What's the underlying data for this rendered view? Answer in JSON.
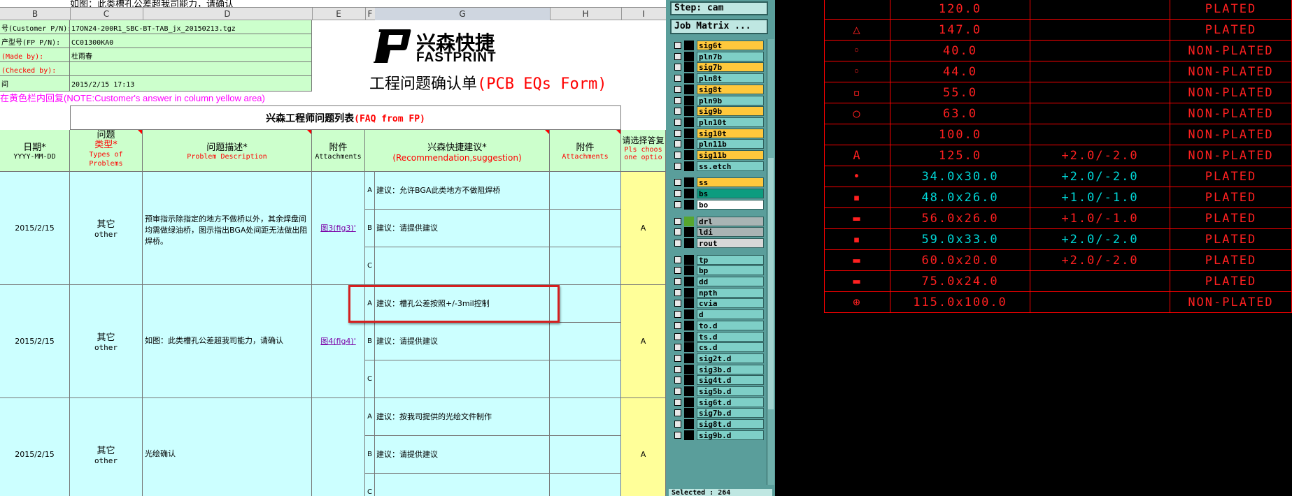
{
  "formula_text": "如图：此类槽孔公差超我司能力，请确认",
  "columns": [
    "B",
    "C",
    "D",
    "E",
    "F",
    "G",
    "H",
    "I"
  ],
  "info": [
    {
      "label": "号(Customer P/N):",
      "value": "17ON24-200R1_SBC-BT-TAB_jx_20150213.tgz"
    },
    {
      "label": "产型号(FP P/N):",
      "value": "CC01300KA0"
    },
    {
      "label": "(Made by):",
      "value": "杜雨春"
    },
    {
      "label": "(Checked by):",
      "value": ""
    },
    {
      "label": "间",
      "value": "2015/2/15 17:13"
    }
  ],
  "logo": {
    "cn": "兴森快捷",
    "en": "FASTPRINT",
    "mark": "P"
  },
  "form_title": {
    "cn": "工程问题确认单",
    "en": "(PCB EQs Form)"
  },
  "note": {
    "cn": "在黄色栏内回复",
    "en": "(NOTE:Customer's answer in column yellow area)"
  },
  "faq_title": {
    "cn": "兴森工程师问题列表",
    "en": "(FAQ from FP)"
  },
  "headers": {
    "date": {
      "cn": "日期*",
      "en": "YYYY-MM-DD"
    },
    "type": {
      "cn": "问题",
      "cn2": "类型*",
      "en": "Types of",
      "en2": "Problems"
    },
    "desc": {
      "cn": "问题描述*",
      "en": "Problem Description"
    },
    "att1": {
      "cn": "附件",
      "en": "Attachments"
    },
    "rec": {
      "cn": "兴森快捷建议*",
      "en": "(Recommendation,suggestion)"
    },
    "att2": {
      "cn": "附件",
      "en": "Attachments"
    },
    "ans": {
      "cn": "请选择答复",
      "en": "Pls choos",
      "en2": "one optio"
    }
  },
  "problems": [
    {
      "date": "2015/2/15",
      "type_cn": "其它",
      "type_en": "other",
      "desc": "预审指示除指定的地方不做桥以外，其余焊盘间均需做绿油桥，图示指出BGA处间距无法做出阻焊桥。",
      "attachment": "图3(fig3)'",
      "options": [
        {
          "letter": "A",
          "text": "建议：允许BGA此类地方不做阻焊桥"
        },
        {
          "letter": "B",
          "text": "建议：请提供建议"
        },
        {
          "letter": "C",
          "text": ""
        }
      ],
      "answer": "A"
    },
    {
      "date": "2015/2/15",
      "type_cn": "其它",
      "type_en": "other",
      "desc": "如图：此类槽孔公差超我司能力，请确认",
      "attachment": "图4(fig4)'",
      "options": [
        {
          "letter": "A",
          "text": "建议：槽孔公差按照+/-3mil控制"
        },
        {
          "letter": "B",
          "text": "建议：请提供建议"
        },
        {
          "letter": "C",
          "text": ""
        }
      ],
      "answer": "A"
    },
    {
      "date": "2015/2/15",
      "type_cn": "其它",
      "type_en": "other",
      "desc": "光绘确认",
      "attachment": "",
      "options": [
        {
          "letter": "A",
          "text": "建议：按我司提供的光绘文件制作"
        },
        {
          "letter": "B",
          "text": "建议：请提供建议"
        },
        {
          "letter": "C",
          "text": ""
        }
      ],
      "answer": "A"
    }
  ],
  "cam": {
    "step": "Step: cam",
    "job_matrix": "Job Matrix ...",
    "selected": "Selected : 264",
    "layers": [
      {
        "name": "sig6t",
        "color": "#ffc83c"
      },
      {
        "name": "pln7b",
        "color": "#7ecfc7"
      },
      {
        "name": "sig7b",
        "color": "#ffc83c"
      },
      {
        "name": "pln8t",
        "color": "#7ecfc7"
      },
      {
        "name": "sig8t",
        "color": "#ffc83c"
      },
      {
        "name": "pln9b",
        "color": "#7ecfc7"
      },
      {
        "name": "sig9b",
        "color": "#ffc83c"
      },
      {
        "name": "pln10t",
        "color": "#7ecfc7"
      },
      {
        "name": "sig10t",
        "color": "#ffc83c"
      },
      {
        "name": "pln11b",
        "color": "#7ecfc7"
      },
      {
        "name": "sig11b",
        "color": "#ffc83c"
      },
      {
        "name": "ss.etch",
        "color": "#7ecfc7"
      },
      {
        "name": "ss",
        "color": "#ffc83c"
      },
      {
        "name": "bs",
        "color": "#0d9c7f"
      },
      {
        "name": "bo",
        "color": "#ffffff"
      },
      {
        "name": "drl",
        "color": "#a9b4b4"
      },
      {
        "name": "ldi",
        "color": "#a9b4b4"
      },
      {
        "name": "rout",
        "color": "#d8d8d8"
      },
      {
        "name": "tp",
        "color": "#7ecfc7"
      },
      {
        "name": "bp",
        "color": "#7ecfc7"
      },
      {
        "name": "dd",
        "color": "#7ecfc7"
      },
      {
        "name": "npth",
        "color": "#7ecfc7"
      },
      {
        "name": "cvia",
        "color": "#7ecfc7"
      },
      {
        "name": "d",
        "color": "#7ecfc7"
      },
      {
        "name": "to.d",
        "color": "#7ecfc7"
      },
      {
        "name": "ts.d",
        "color": "#7ecfc7"
      },
      {
        "name": "cs.d",
        "color": "#7ecfc7"
      },
      {
        "name": "sig2t.d",
        "color": "#7ecfc7"
      },
      {
        "name": "sig3b.d",
        "color": "#7ecfc7"
      },
      {
        "name": "sig4t.d",
        "color": "#7ecfc7"
      },
      {
        "name": "sig5b.d",
        "color": "#7ecfc7"
      },
      {
        "name": "sig6t.d",
        "color": "#7ecfc7"
      },
      {
        "name": "sig7b.d",
        "color": "#7ecfc7"
      },
      {
        "name": "sig8t.d",
        "color": "#7ecfc7"
      },
      {
        "name": "sig9b.d",
        "color": "#7ecfc7"
      }
    ]
  },
  "drill_rows": [
    {
      "symbol": "",
      "size": "120.0",
      "tol": "",
      "type": "PLATED",
      "color": "red"
    },
    {
      "symbol": "△",
      "size": "147.0",
      "tol": "",
      "type": "PLATED",
      "color": "red"
    },
    {
      "symbol": "◦",
      "size": "40.0",
      "tol": "",
      "type": "NON-PLATED",
      "color": "red"
    },
    {
      "symbol": "◦",
      "size": "44.0",
      "tol": "",
      "type": "NON-PLATED",
      "color": "red"
    },
    {
      "symbol": "▫",
      "size": "55.0",
      "tol": "",
      "type": "NON-PLATED",
      "color": "red"
    },
    {
      "symbol": "○",
      "size": "63.0",
      "tol": "",
      "type": "NON-PLATED",
      "color": "red"
    },
    {
      "symbol": "",
      "size": "100.0",
      "tol": "",
      "type": "NON-PLATED",
      "color": "red"
    },
    {
      "symbol": "A",
      "size": "125.0",
      "tol": "+2.0/-2.0",
      "type": "NON-PLATED",
      "color": "red"
    },
    {
      "symbol": "•",
      "size": "34.0x30.0",
      "tol": "+2.0/-2.0",
      "type": "PLATED",
      "color": "cyan"
    },
    {
      "symbol": "▪",
      "size": "48.0x26.0",
      "tol": "+1.0/-1.0",
      "type": "PLATED",
      "color": "cyan"
    },
    {
      "symbol": "▬",
      "size": "56.0x26.0",
      "tol": "+1.0/-1.0",
      "type": "PLATED",
      "color": "red"
    },
    {
      "symbol": "▪",
      "size": "59.0x33.0",
      "tol": "+2.0/-2.0",
      "type": "PLATED",
      "color": "cyan"
    },
    {
      "symbol": "▬",
      "size": "60.0x20.0",
      "tol": "+2.0/-2.0",
      "type": "PLATED",
      "color": "red"
    },
    {
      "symbol": "▬",
      "size": "75.0x24.0",
      "tol": "",
      "type": "PLATED",
      "color": "red"
    },
    {
      "symbol": "⊕",
      "size": "115.0x100.0",
      "tol": "",
      "type": "NON-PLATED",
      "color": "red"
    }
  ]
}
